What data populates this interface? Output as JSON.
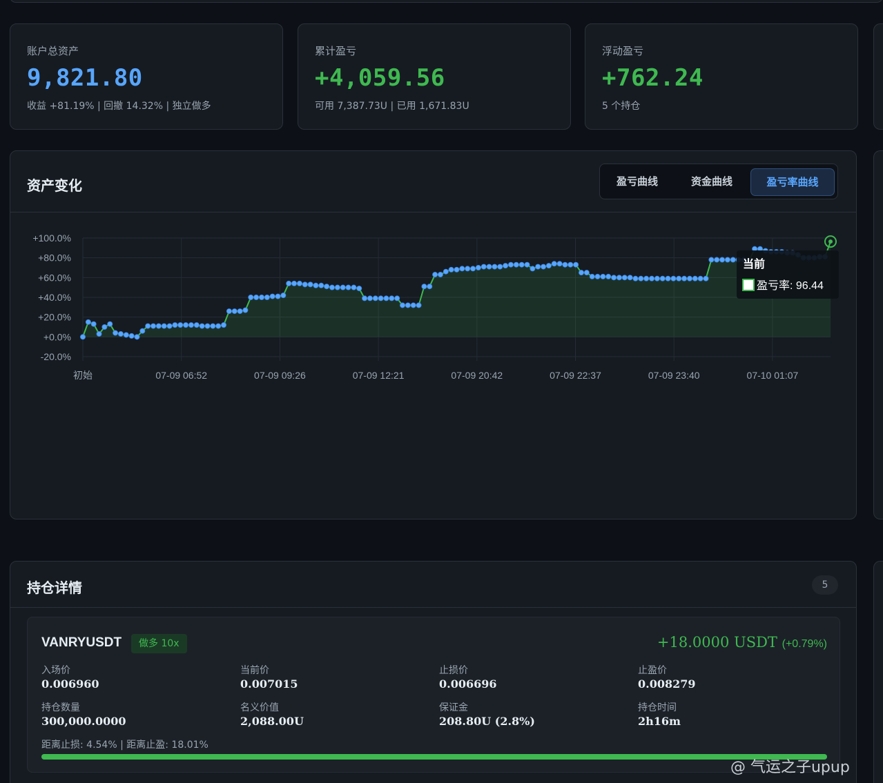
{
  "stats": [
    {
      "label": "账户总资产",
      "value": "9,821.80",
      "sub": "收益 +81.19% | 回撤 14.32% | 独立做多"
    },
    {
      "label": "累计盈亏",
      "value": "+4,059.56",
      "sub": "可用 7,387.73U | 已用 1,671.83U"
    },
    {
      "label": "浮动盈亏",
      "value": "+762.24",
      "sub": "5 个持仓"
    }
  ],
  "asset_section": {
    "title": "资产变化",
    "tabs": [
      "盈亏曲线",
      "资金曲线",
      "盈亏率曲线"
    ],
    "active_tab": "盈亏率曲线",
    "tooltip": {
      "title": "当前",
      "label": "盈亏率: 96.44"
    }
  },
  "chart_data": {
    "type": "area",
    "y_ticks": [
      "+100.0%",
      "+80.0%",
      "+60.0%",
      "+40.0%",
      "+20.0%",
      "+0.0%",
      "-20.0%"
    ],
    "ylim": [
      -20,
      100
    ],
    "x_tick_labels": [
      "初始",
      "07-09 06:52",
      "07-09 09:26",
      "07-09 12:21",
      "07-09 20:42",
      "07-09 22:37",
      "07-09 23:40",
      "07-10 01:07"
    ],
    "series": [
      {
        "values": [
          0,
          15,
          13,
          3,
          10,
          13,
          4,
          3,
          2,
          1,
          0,
          6,
          11,
          11,
          11,
          11,
          11,
          12,
          12,
          12,
          12,
          12,
          11,
          11,
          11,
          11,
          12,
          26,
          26,
          26,
          27,
          40,
          40,
          40,
          40,
          41,
          41,
          42,
          54,
          54,
          54,
          53,
          53,
          52,
          52,
          51,
          50,
          50,
          50,
          50,
          50,
          49,
          39,
          39,
          39,
          39,
          39,
          39,
          39,
          32,
          32,
          32,
          32,
          51,
          51,
          63,
          63,
          66,
          68,
          68,
          69,
          69,
          69,
          70,
          71,
          71,
          71,
          71,
          72,
          73,
          73,
          73,
          73,
          69,
          71,
          71,
          72,
          74,
          74,
          73,
          73,
          73,
          65,
          65,
          61,
          61,
          61,
          61,
          60,
          60,
          60,
          60,
          59,
          59,
          59,
          59,
          59,
          59,
          59,
          59,
          59,
          59,
          59,
          59,
          59,
          59,
          78,
          78,
          78,
          78,
          78,
          78,
          78,
          77,
          89,
          89,
          87,
          86,
          86,
          86,
          85,
          85,
          83,
          80,
          80,
          80,
          81,
          81,
          96.44
        ]
      }
    ],
    "line_color": "#3fb950",
    "point_color": "#58a6ff",
    "grid": true
  },
  "positions_section": {
    "title": "持仓详情",
    "count": "5",
    "positions": [
      {
        "symbol": "VANRYUSDT",
        "side_badge": "做多 10x",
        "pnl": "+18.0000 USDT",
        "pnl_pct": "(+0.79%)",
        "fields": [
          {
            "k": "入场价",
            "v": "0.006960",
            "color": "#e6edf3"
          },
          {
            "k": "当前价",
            "v": "0.007015",
            "color": "#e6edf3"
          },
          {
            "k": "止损价",
            "v": "0.006696",
            "color": "#f85149"
          },
          {
            "k": "止盈价",
            "v": "0.008279",
            "color": "#3fb950"
          },
          {
            "k": "持仓数量",
            "v": "300,000.0000",
            "color": "#e6edf3"
          },
          {
            "k": "名义价值",
            "v": "2,088.00U",
            "color": "#e6edf3"
          },
          {
            "k": "保证金",
            "v": "208.80U (2.8%)",
            "color": "#e6edf3"
          },
          {
            "k": "持仓时间",
            "v": "2h16m",
            "color": "#e6edf3"
          }
        ],
        "distance": "距离止损: 4.54% | 距离止盈: 18.01%",
        "progress": 1.0
      }
    ]
  },
  "watermark": "@ 气运之子upup"
}
